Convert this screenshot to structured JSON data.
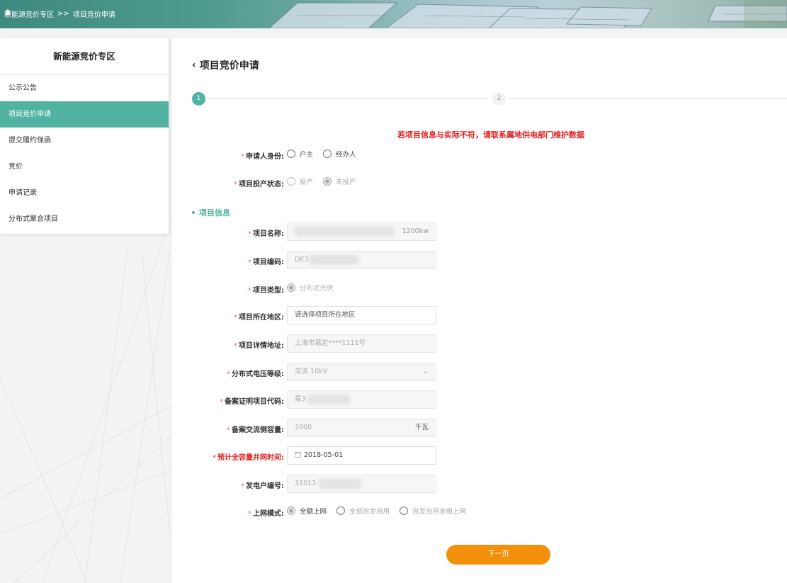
{
  "breadcrumb": {
    "home_icon": "home-icon",
    "level1": "新能源竞价专区",
    "separator": ">>",
    "level2": "项目竞价申请"
  },
  "sidebar": {
    "title": "新能源竞价专区",
    "items": [
      {
        "label": "公示公告",
        "active": false
      },
      {
        "label": "项目竞价申请",
        "active": true
      },
      {
        "label": "提交履约保函",
        "active": false
      },
      {
        "label": "竞价",
        "active": false
      },
      {
        "label": "申请记录",
        "active": false
      },
      {
        "label": "分布式聚合项目",
        "active": false
      }
    ]
  },
  "page": {
    "back_icon": "chevron-left-icon",
    "title": "项目竞价申请"
  },
  "stepper": {
    "step1": "1",
    "step2": "2"
  },
  "warning": "若项目信息与实际不符，请联系属地供电部门维护数据",
  "form": {
    "applicant": {
      "label": "申请人身份:",
      "options": [
        "户主",
        "经办人"
      ]
    },
    "status": {
      "label": "项目投产状态:",
      "options": [
        "投产",
        "未投产"
      ],
      "selected": "未投产"
    },
    "section_title": "项目信息",
    "project_name": {
      "label": "项目名称:",
      "suffix": "1200kw"
    },
    "project_code": {
      "label": "项目编码:",
      "value": "DE3"
    },
    "project_type": {
      "label": "项目类型:",
      "option": "分布式光伏"
    },
    "region": {
      "label": "项目所在地区:",
      "placeholder": "请选择项目所在地区"
    },
    "address": {
      "label": "项目详情地址:",
      "value": "上海市嘉定****1111号"
    },
    "voltage": {
      "label": "分布式电压等级:",
      "value": "交流 10kV"
    },
    "record_code": {
      "label": "备案证明项目代码:",
      "value": "嘉3"
    },
    "capacity": {
      "label": "备案交流侧容量:",
      "value": "1000",
      "unit": "千瓦"
    },
    "grid_time": {
      "label": "预计全容量并网时间:",
      "value": "2018-05-01"
    },
    "household": {
      "label": "发电户编号:",
      "value": "31013"
    },
    "grid_mode": {
      "label": "上网模式:",
      "options": [
        "全额上网",
        "全部自发自用",
        "自发自用余电上网"
      ],
      "selected": "全额上网"
    }
  },
  "buttons": {
    "next": "下一页"
  },
  "colors": {
    "accent": "#52b3a2",
    "warning": "#e02020",
    "button": "#f2900c"
  }
}
